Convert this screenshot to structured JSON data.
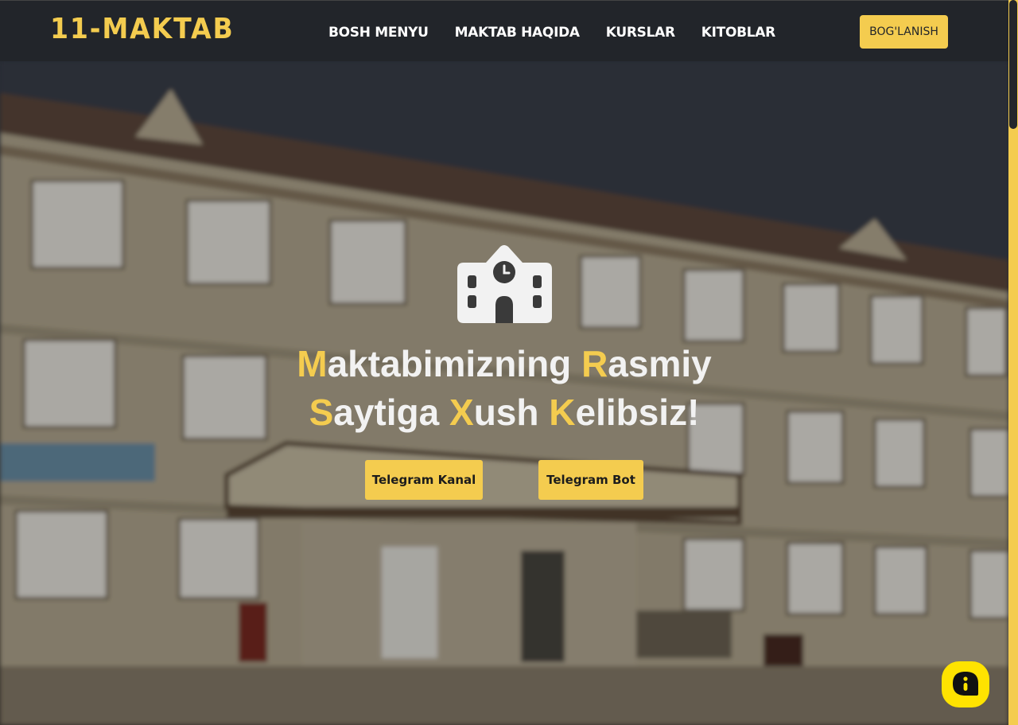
{
  "brand": {
    "name": "11-MAKTAB"
  },
  "nav": {
    "items": [
      {
        "label": "BOSH MENYU"
      },
      {
        "label": "MAKTAB HAQIDA"
      },
      {
        "label": "KURSLAR"
      },
      {
        "label": "KITOBLAR"
      }
    ],
    "contact_label": "BOG'LANISH"
  },
  "hero": {
    "line1": [
      {
        "text": "M",
        "highlight": true
      },
      {
        "text": "aktabimizning ",
        "highlight": false
      },
      {
        "text": "R",
        "highlight": true
      },
      {
        "text": "asmiy",
        "highlight": false
      }
    ],
    "line2": [
      {
        "text": "S",
        "highlight": true
      },
      {
        "text": "aytiga ",
        "highlight": false
      },
      {
        "text": "X",
        "highlight": true
      },
      {
        "text": "ush ",
        "highlight": false
      },
      {
        "text": "K",
        "highlight": true
      },
      {
        "text": "elibsiz!",
        "highlight": false
      }
    ],
    "buttons": {
      "kanal": "Telegram Kanal",
      "bot": "Telegram Bot"
    }
  },
  "icons": {
    "hero_icon": "school-icon",
    "chat_icon": "chat-bubble-icon"
  },
  "colors": {
    "accent": "#f4cc4f",
    "navbar": "#22252a",
    "chat": "#ffe300"
  }
}
